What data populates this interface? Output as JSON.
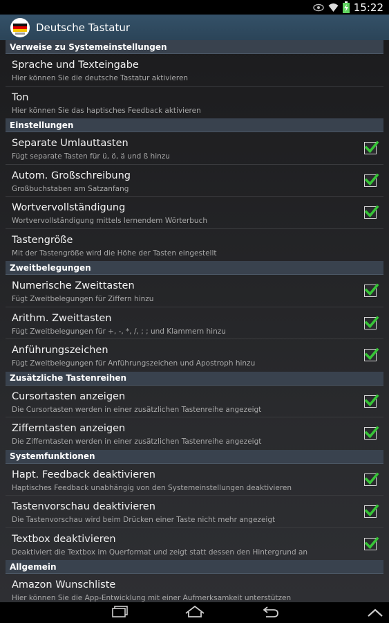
{
  "status_bar": {
    "time": "15:22",
    "icons": [
      "eye-icon",
      "wifi-icon",
      "battery-charging-icon"
    ]
  },
  "action_bar": {
    "title": "Deutsche Tastatur",
    "app_icon": "german-keyboard-icon"
  },
  "sections": [
    {
      "header": "Verweise zu Systemeinstellungen",
      "items": [
        {
          "title": "Sprache und Texteingabe",
          "summary": "Hier können Sie die deutsche Tastatur aktivieren",
          "checkbox": false
        },
        {
          "title": "Ton",
          "summary": "Hier können Sie das haptisches Feedback aktivieren",
          "checkbox": false
        }
      ]
    },
    {
      "header": "Einstellungen",
      "items": [
        {
          "title": "Separate Umlauttasten",
          "summary": "Fügt separate Tasten für ü, ö, ä und ß hinzu",
          "checkbox": true,
          "checked": true
        },
        {
          "title": "Autom. Großschreibung",
          "summary": "Großbuchstaben am Satzanfang",
          "checkbox": true,
          "checked": true
        },
        {
          "title": "Wortvervollständigung",
          "summary": "Wortvervollständigung mittels lernendem Wörterbuch",
          "checkbox": true,
          "checked": true
        },
        {
          "title": "Tastengröße",
          "summary": "Mit der Tastengröße wird die Höhe der Tasten eingestellt",
          "checkbox": false
        }
      ]
    },
    {
      "header": "Zweitbelegungen",
      "items": [
        {
          "title": "Numerische Zweittasten",
          "summary": "Fügt Zweitbelegungen für Ziffern hinzu",
          "checkbox": true,
          "checked": true
        },
        {
          "title": "Arithm. Zweittasten",
          "summary": "Fügt Zweitbelegungen für +, -, *, /, ; ; und Klammern hinzu",
          "checkbox": true,
          "checked": true
        },
        {
          "title": "Anführungszeichen",
          "summary": "Fügt Zweitbelegungen für Anführungszeichen und Apostroph hinzu",
          "checkbox": true,
          "checked": true
        }
      ]
    },
    {
      "header": "Zusätzliche Tastenreihen",
      "items": [
        {
          "title": "Cursortasten anzeigen",
          "summary": "Die Cursortasten werden in einer zusätzlichen Tastenreihe angezeigt",
          "checkbox": true,
          "checked": true
        },
        {
          "title": "Zifferntasten anzeigen",
          "summary": "Die Zifferntasten werden in einer zusätzlichen Tastenreihe angezeigt",
          "checkbox": true,
          "checked": true
        }
      ]
    },
    {
      "header": "Systemfunktionen",
      "items": [
        {
          "title": "Hapt. Feedback deaktivieren",
          "summary": "Haptisches Feedback unabhängig von den Systemeinstellungen deaktivieren",
          "checkbox": true,
          "checked": true
        },
        {
          "title": "Tastenvorschau deaktivieren",
          "summary": "Die Tastenvorschau wird beim Drücken einer Taste nicht mehr angezeigt",
          "checkbox": true,
          "checked": true
        },
        {
          "title": "Textbox deaktivieren",
          "summary": "Deaktiviert die Textbox im Querformat und zeigt statt dessen den Hintergrund an",
          "checkbox": true,
          "checked": true
        }
      ]
    },
    {
      "header": "Allgemein",
      "items": [
        {
          "title": "Amazon Wunschliste",
          "summary": "Hier können Sie die App-Entwicklung mit einer Aufmerksamkeit unterstützen",
          "checkbox": false
        }
      ]
    }
  ],
  "nav_bar": {
    "buttons": [
      "recent-apps-icon",
      "home-icon",
      "back-icon",
      "chevron-up-icon"
    ]
  },
  "colors": {
    "action_bar": "#2b4458",
    "section_header": "#39424e",
    "checkmark": "#37c437"
  }
}
